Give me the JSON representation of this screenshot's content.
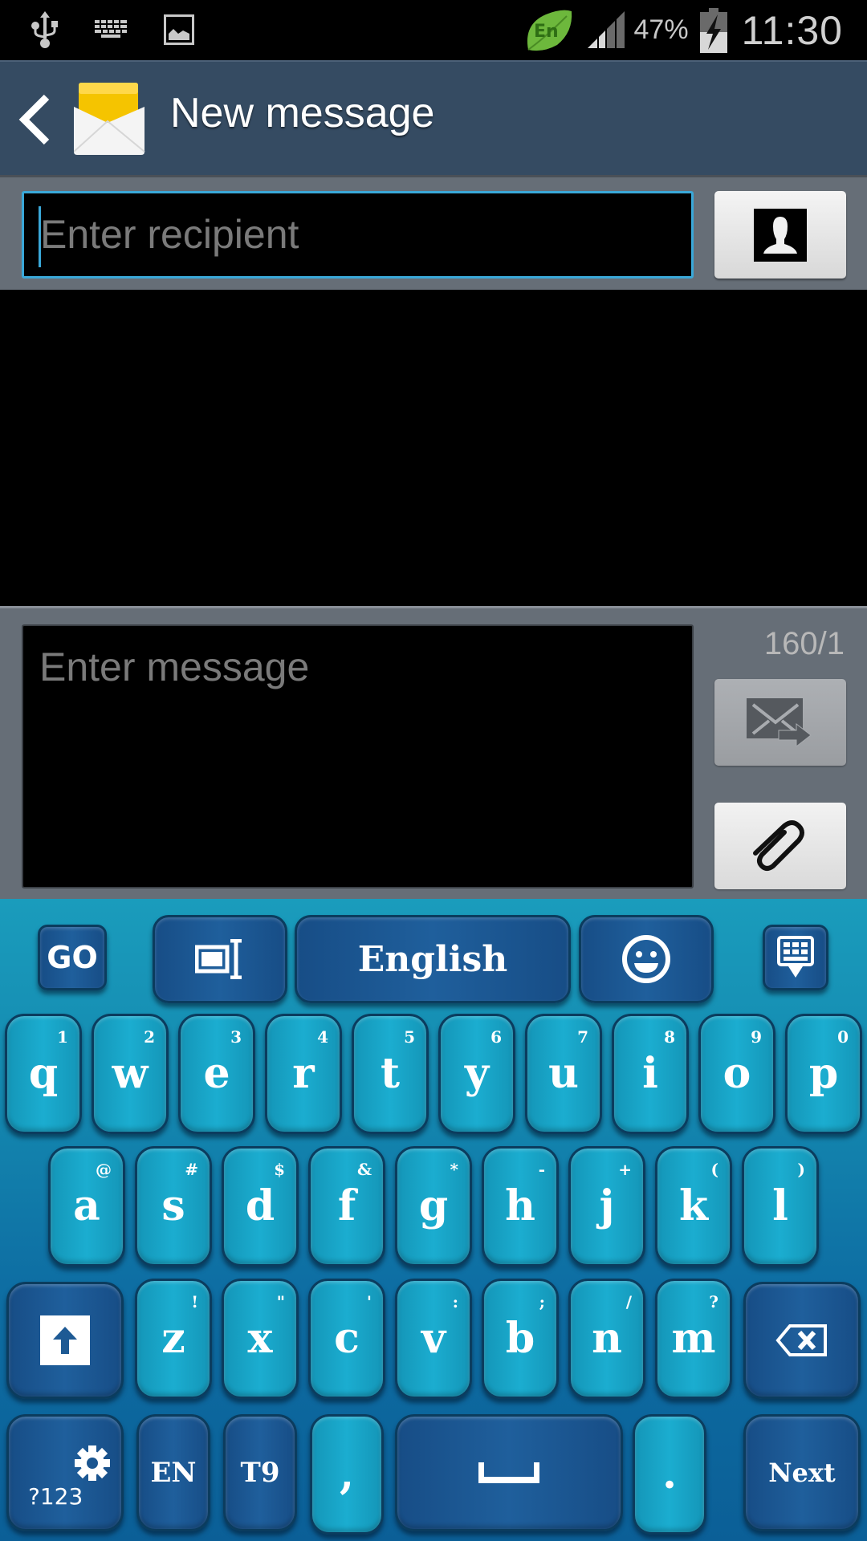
{
  "status_bar": {
    "left_icons": [
      "usb-icon",
      "keyboard-icon",
      "image-icon"
    ],
    "language_badge": "En",
    "battery_percent": "47%",
    "time": "11:30",
    "right_icons": [
      "language-leaf-icon",
      "signal-icon",
      "battery-charging-icon"
    ]
  },
  "action_bar": {
    "title": "New message",
    "back_icon": "chevron-left-icon",
    "app_icon": "envelope-icon"
  },
  "recipient": {
    "placeholder": "Enter recipient",
    "value": "",
    "contact_button_icon": "contact-icon"
  },
  "compose": {
    "placeholder": "Enter message",
    "value": "",
    "char_counter": "160/1",
    "send_button_icon": "send-message-icon",
    "attach_button_icon": "paperclip-icon"
  },
  "keyboard": {
    "accent_light": "#1badd0",
    "accent_dark": "#1f5f9c",
    "toolbar": {
      "go_label": "GO",
      "language_label": "English",
      "cursor_icon": "text-cursor-icon",
      "emoji_icon": "emoji-icon",
      "hide_icon": "hide-keyboard-icon"
    },
    "row1": [
      {
        "key": "q",
        "hint": "1"
      },
      {
        "key": "w",
        "hint": "2"
      },
      {
        "key": "e",
        "hint": "3"
      },
      {
        "key": "r",
        "hint": "4"
      },
      {
        "key": "t",
        "hint": "5"
      },
      {
        "key": "y",
        "hint": "6"
      },
      {
        "key": "u",
        "hint": "7"
      },
      {
        "key": "i",
        "hint": "8"
      },
      {
        "key": "o",
        "hint": "9"
      },
      {
        "key": "p",
        "hint": "0"
      }
    ],
    "row2": [
      {
        "key": "a",
        "hint": "@"
      },
      {
        "key": "s",
        "hint": "#"
      },
      {
        "key": "d",
        "hint": "$"
      },
      {
        "key": "f",
        "hint": "&"
      },
      {
        "key": "g",
        "hint": "*"
      },
      {
        "key": "h",
        "hint": "-"
      },
      {
        "key": "j",
        "hint": "+"
      },
      {
        "key": "k",
        "hint": "("
      },
      {
        "key": "l",
        "hint": ")"
      }
    ],
    "row3": [
      {
        "key": "z",
        "hint": "!"
      },
      {
        "key": "x",
        "hint": "\""
      },
      {
        "key": "c",
        "hint": "'"
      },
      {
        "key": "v",
        "hint": ":"
      },
      {
        "key": "b",
        "hint": ";"
      },
      {
        "key": "n",
        "hint": "/"
      },
      {
        "key": "m",
        "hint": "?"
      }
    ],
    "bottom": {
      "symbols_label": "?123",
      "lang_label": "EN",
      "t9_label": "T9",
      "comma": ",",
      "period": ".",
      "next_label": "Next"
    }
  }
}
